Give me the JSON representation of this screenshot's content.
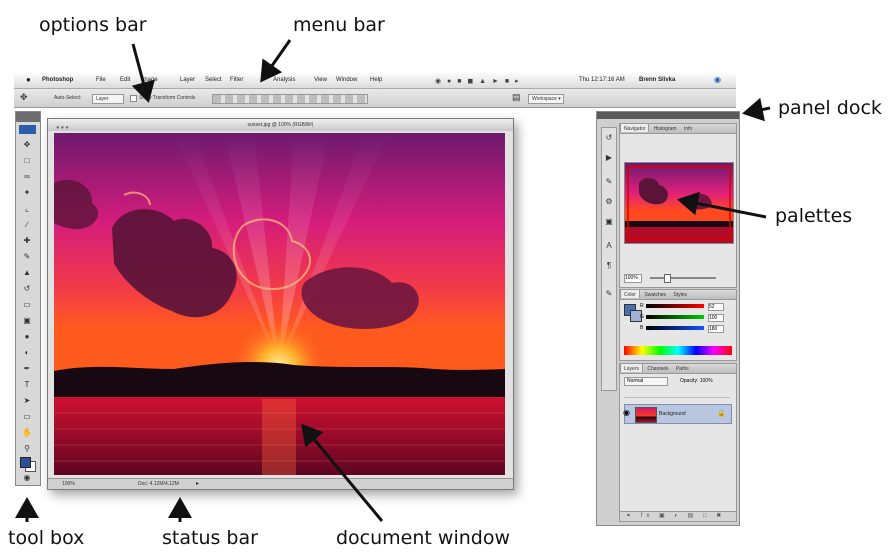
{
  "callouts": {
    "options_bar": "options bar",
    "menu_bar": "menu bar",
    "panel_dock": "panel dock",
    "palettes": "palettes",
    "tool_box": "tool box",
    "status_bar": "status bar",
    "document_window": "document window"
  },
  "menubar": {
    "app_name": "Photoshop",
    "items": [
      "File",
      "Edit",
      "Image",
      "Layer",
      "Select",
      "Filter",
      "Analysis",
      "View",
      "Window",
      "Help"
    ],
    "clock": "Thu 12:17:16 AM",
    "user": "Brenn Slivka"
  },
  "optionsbar": {
    "auto_select": "Auto-Select:",
    "auto_select_value": "Layer",
    "transform_controls": "Show Transform Controls",
    "workspace": "Workspace ▾"
  },
  "document": {
    "title": "sunset.jpg @ 100% (RGB/8#)",
    "status_zoom": "100%",
    "status_info": "Doc: 4.12M/4.12M"
  },
  "panels": {
    "navigator_tabs": [
      "Navigator",
      "Histogram",
      "Info"
    ],
    "navigator_zoom": "100%",
    "color_tabs": [
      "Color",
      "Swatches",
      "Styles"
    ],
    "color_channels": [
      "R",
      "G",
      "B"
    ],
    "color_values": [
      "52",
      "100",
      "180"
    ],
    "layers_tabs": [
      "Layers",
      "Channels",
      "Paths"
    ],
    "blend_mode": "Normal",
    "opacity": "Opacity: 100%",
    "layer_name": "Background"
  },
  "colors": {
    "sky_top": "#7a1a6a",
    "sky_mid": "#e0207a",
    "horizon": "#ff4020",
    "sun": "#ffcf4a",
    "water": "#b00c2a",
    "land": "#1a0a18"
  },
  "icons": [
    "apple-icon",
    "move-tool-icon",
    "marquee-tool-icon",
    "lasso-tool-icon",
    "crop-tool-icon",
    "brush-tool-icon",
    "eraser-tool-icon",
    "type-tool-icon",
    "hand-tool-icon",
    "zoom-tool-icon",
    "spotlight-icon"
  ]
}
